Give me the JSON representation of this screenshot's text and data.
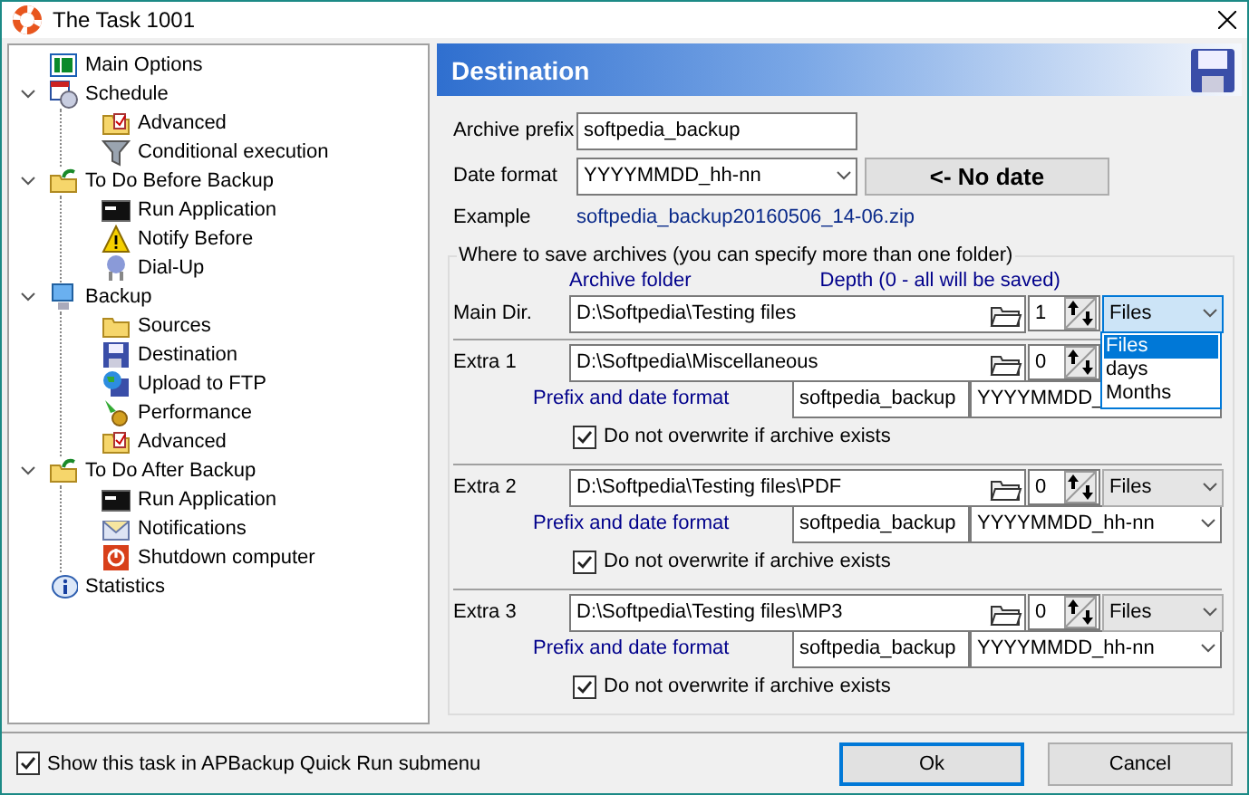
{
  "window": {
    "title": "The Task 1001"
  },
  "tree": [
    {
      "label": "Main Options"
    },
    {
      "label": "Schedule",
      "expanded": true,
      "children": [
        {
          "label": "Advanced"
        },
        {
          "label": "Conditional execution"
        }
      ]
    },
    {
      "label": "To Do Before Backup",
      "expanded": true,
      "children": [
        {
          "label": "Run Application"
        },
        {
          "label": "Notify Before"
        },
        {
          "label": "Dial-Up"
        }
      ]
    },
    {
      "label": "Backup",
      "expanded": true,
      "children": [
        {
          "label": "Sources"
        },
        {
          "label": "Destination"
        },
        {
          "label": "Upload to FTP"
        },
        {
          "label": "Performance"
        },
        {
          "label": "Advanced"
        }
      ]
    },
    {
      "label": "To Do After Backup",
      "expanded": true,
      "children": [
        {
          "label": "Run Application"
        },
        {
          "label": "Notifications"
        },
        {
          "label": "Shutdown computer"
        }
      ]
    },
    {
      "label": "Statistics"
    }
  ],
  "panel": {
    "title": "Destination"
  },
  "archive_prefix": {
    "label": "Archive prefix",
    "value": "softpedia_backup"
  },
  "date_format": {
    "label": "Date format",
    "value": "YYYYMMDD_hh-nn"
  },
  "no_date_button": "<- No date",
  "example": {
    "label": "Example",
    "value": "softpedia_backup20160506_14-06.zip"
  },
  "group": {
    "title": "Where to save archives (you can specify more than one folder)",
    "column_1": "Archive folder",
    "column_2": "Depth (0 - all will be saved)",
    "folders": [
      {
        "label": "Main Dir.",
        "path": "D:\\Softpedia\\Testing files",
        "depth": "1",
        "unit": "Files",
        "open": true
      },
      {
        "label": "Extra 1",
        "path": "D:\\Softpedia\\Miscellaneous",
        "depth": "0",
        "prefix_label": "Prefix and date format",
        "prefix": "softpedia_backup",
        "date_format": "YYYYMMDD_",
        "no_overwrite": {
          "label": "Do not overwrite if archive exists",
          "checked": true
        }
      },
      {
        "label": "Extra 2",
        "path": "D:\\Softpedia\\Testing files\\PDF",
        "depth": "0",
        "unit": "Files",
        "open": false,
        "prefix_label": "Prefix and date format",
        "prefix": "softpedia_backup",
        "date_format": "YYYYMMDD_hh-nn",
        "no_overwrite": {
          "label": "Do not overwrite if archive exists",
          "checked": true
        }
      },
      {
        "label": "Extra 3",
        "path": "D:\\Softpedia\\Testing files\\MP3",
        "depth": "0",
        "unit": "Files",
        "open": false,
        "prefix_label": "Prefix and date format",
        "prefix": "softpedia_backup",
        "date_format": "YYYYMMDD_hh-nn",
        "no_overwrite": {
          "label": "Do not overwrite if archive exists",
          "checked": true
        }
      }
    ]
  },
  "dropdown": {
    "options": [
      {
        "label": "Files",
        "selected": true
      },
      {
        "label": "days",
        "selected": false
      },
      {
        "label": "Months",
        "selected": false
      }
    ]
  },
  "show_in_menu": {
    "label": "Show this task in APBackup Quick Run submenu",
    "checked": true
  },
  "buttons": [
    {
      "label": "Ok",
      "default": true
    },
    {
      "label": "Cancel",
      "default": false
    }
  ]
}
